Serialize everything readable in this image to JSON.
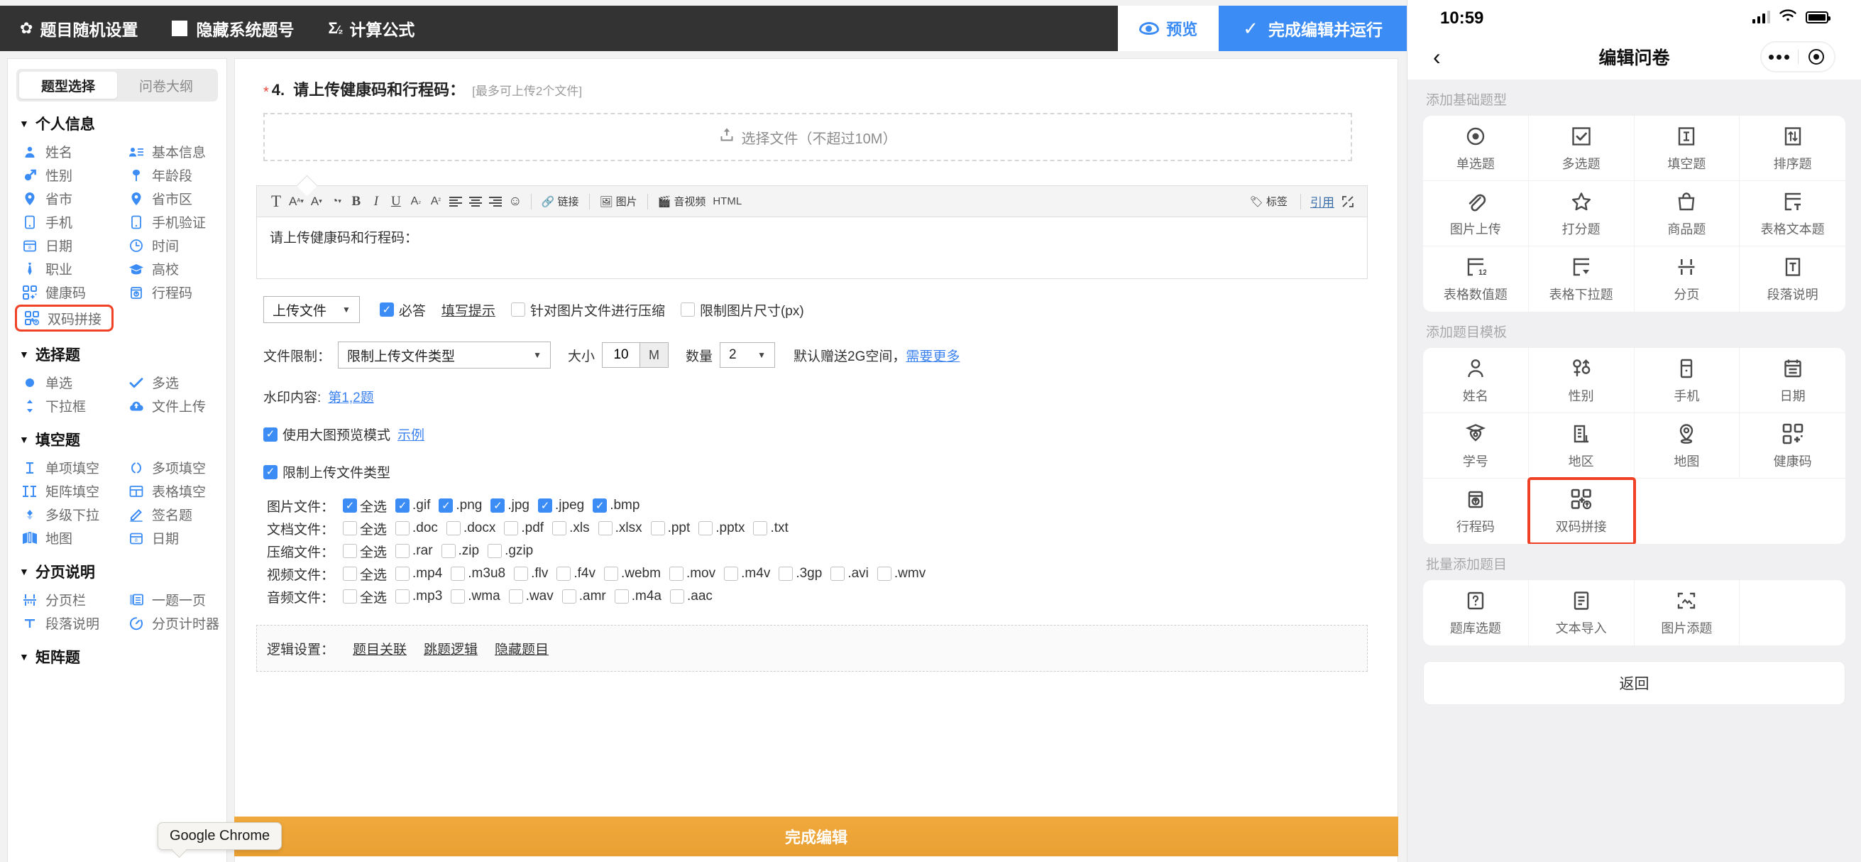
{
  "topbar": {
    "random_settings": "题目随机设置",
    "hide_number": "隐藏系统题号",
    "formula": "计算公式",
    "preview": "预览",
    "finish_run": "完成编辑并运行"
  },
  "sidebar": {
    "tabs": [
      {
        "label": "题型选择",
        "active": true
      },
      {
        "label": "问卷大纲",
        "active": false
      }
    ],
    "groups": [
      {
        "title": "个人信息",
        "items": [
          {
            "label": "姓名",
            "icon": "person-icon"
          },
          {
            "label": "基本信息",
            "icon": "id-card-icon"
          },
          {
            "label": "性别",
            "icon": "gender-icon"
          },
          {
            "label": "年龄段",
            "icon": "age-icon"
          },
          {
            "label": "省市",
            "icon": "pin-icon"
          },
          {
            "label": "省市区",
            "icon": "pin-icon"
          },
          {
            "label": "手机",
            "icon": "phone-icon"
          },
          {
            "label": "手机验证",
            "icon": "phone-verify-icon"
          },
          {
            "label": "日期",
            "icon": "calendar-icon"
          },
          {
            "label": "时间",
            "icon": "clock-icon"
          },
          {
            "label": "职业",
            "icon": "tie-icon"
          },
          {
            "label": "高校",
            "icon": "graduation-icon"
          },
          {
            "label": "健康码",
            "icon": "qrcode-icon"
          },
          {
            "label": "行程码",
            "icon": "travelcode-icon"
          },
          {
            "label": "双码拼接",
            "icon": "dualcode-icon",
            "highlight": true
          }
        ]
      },
      {
        "title": "选择题",
        "items": [
          {
            "label": "单选",
            "icon": "radio-icon"
          },
          {
            "label": "多选",
            "icon": "check-icon"
          },
          {
            "label": "下拉框",
            "icon": "dropdown-icon"
          },
          {
            "label": "文件上传",
            "icon": "cloud-upload-icon"
          }
        ]
      },
      {
        "title": "填空题",
        "items": [
          {
            "label": "单项填空",
            "icon": "text-i-icon"
          },
          {
            "label": "多项填空",
            "icon": "parens-icon"
          },
          {
            "label": "矩阵填空",
            "icon": "text-ii-icon"
          },
          {
            "label": "表格填空",
            "icon": "table-icon"
          },
          {
            "label": "多级下拉",
            "icon": "multi-dropdown-icon"
          },
          {
            "label": "签名题",
            "icon": "signature-icon"
          },
          {
            "label": "地图",
            "icon": "map-icon"
          },
          {
            "label": "日期",
            "icon": "calendar-icon"
          }
        ]
      },
      {
        "title": "分页说明",
        "items": [
          {
            "label": "分页栏",
            "icon": "pagebreak-icon"
          },
          {
            "label": "一题一页",
            "icon": "one-per-page-icon"
          },
          {
            "label": "段落说明",
            "icon": "paragraph-icon"
          },
          {
            "label": "分页计时器",
            "icon": "timer-icon"
          }
        ]
      },
      {
        "title": "矩阵题",
        "items": []
      }
    ]
  },
  "question": {
    "required_mark": "*",
    "number": "4.",
    "title": "请上传健康码和行程码：",
    "hint": "[最多可上传2个文件]",
    "dropzone_text": "选择文件（不超过10M）"
  },
  "editor": {
    "buttons": [
      "T",
      "A",
      "A",
      "pen",
      "B",
      "I",
      "U",
      "As",
      "As"
    ],
    "align": [
      "align-left",
      "align-center",
      "align-right"
    ],
    "emoji": "☺",
    "link_label": "链接",
    "image_label": "图片",
    "media_label": "音视频",
    "html_label": "HTML",
    "tag_label": "标签",
    "quote_label": "引用",
    "body_text": "请上传健康码和行程码："
  },
  "settings": {
    "type_select": "上传文件",
    "required_label": "必答",
    "required_checked": true,
    "fill_hint_link": "填写提示",
    "compress_label": "针对图片文件进行压缩",
    "compress_checked": false,
    "limit_size_label": "限制图片尺寸(px)",
    "limit_size_checked": false,
    "file_limit_label": "文件限制：",
    "file_limit_value": "限制上传文件类型",
    "size_label": "大小",
    "size_value": "10",
    "size_unit": "M",
    "count_label": "数量",
    "count_value": "2",
    "storage_note": "默认赠送2G空间，",
    "storage_link": "需要更多",
    "watermark_label": "水印内容:",
    "watermark_link": "第1,2题",
    "big_preview_label": "使用大图预览模式",
    "big_preview_checked": true,
    "big_preview_link": "示例",
    "restrict_types_label": "限制上传文件类型",
    "restrict_types_checked": true
  },
  "file_types": [
    {
      "label": "图片文件：",
      "all_label": "全选",
      "all_checked": true,
      "options": [
        {
          "label": ".gif",
          "checked": true
        },
        {
          "label": ".png",
          "checked": true
        },
        {
          "label": ".jpg",
          "checked": true
        },
        {
          "label": ".jpeg",
          "checked": true
        },
        {
          "label": ".bmp",
          "checked": true
        }
      ]
    },
    {
      "label": "文档文件：",
      "all_label": "全选",
      "all_checked": false,
      "options": [
        {
          "label": ".doc",
          "checked": false
        },
        {
          "label": ".docx",
          "checked": false
        },
        {
          "label": ".pdf",
          "checked": false
        },
        {
          "label": ".xls",
          "checked": false
        },
        {
          "label": ".xlsx",
          "checked": false
        },
        {
          "label": ".ppt",
          "checked": false
        },
        {
          "label": ".pptx",
          "checked": false
        },
        {
          "label": ".txt",
          "checked": false
        }
      ]
    },
    {
      "label": "压缩文件：",
      "all_label": "全选",
      "all_checked": false,
      "options": [
        {
          "label": ".rar",
          "checked": false
        },
        {
          "label": ".zip",
          "checked": false
        },
        {
          "label": ".gzip",
          "checked": false
        }
      ]
    },
    {
      "label": "视频文件：",
      "all_label": "全选",
      "all_checked": false,
      "options": [
        {
          "label": ".mp4",
          "checked": false
        },
        {
          "label": ".m3u8",
          "checked": false
        },
        {
          "label": ".flv",
          "checked": false
        },
        {
          "label": ".f4v",
          "checked": false
        },
        {
          "label": ".webm",
          "checked": false
        },
        {
          "label": ".mov",
          "checked": false
        },
        {
          "label": ".m4v",
          "checked": false
        },
        {
          "label": ".3gp",
          "checked": false
        },
        {
          "label": ".avi",
          "checked": false
        },
        {
          "label": ".wmv",
          "checked": false
        }
      ]
    },
    {
      "label": "音频文件：",
      "all_label": "全选",
      "all_checked": false,
      "options": [
        {
          "label": ".mp3",
          "checked": false
        },
        {
          "label": ".wma",
          "checked": false
        },
        {
          "label": ".wav",
          "checked": false
        },
        {
          "label": ".amr",
          "checked": false
        },
        {
          "label": ".m4a",
          "checked": false
        },
        {
          "label": ".aac",
          "checked": false
        }
      ]
    }
  ],
  "logic": {
    "label": "逻辑设置：",
    "links": [
      "题目关联",
      "跳题逻辑",
      "隐藏题目"
    ]
  },
  "finish_bar": {
    "label": "完成编辑"
  },
  "tooltip": {
    "text": "Google Chrome"
  },
  "phone": {
    "status": {
      "time": "10:59"
    },
    "nav": {
      "title": "编辑问卷",
      "back": "‹"
    },
    "sections": [
      {
        "title": "添加基础题型",
        "items": [
          {
            "label": "单选题",
            "icon": "radio-dot-icon"
          },
          {
            "label": "多选题",
            "icon": "checkbox-icon"
          },
          {
            "label": "填空题",
            "icon": "text-field-icon"
          },
          {
            "label": "排序题",
            "icon": "sort-icon"
          },
          {
            "label": "图片上传",
            "icon": "paperclip-icon"
          },
          {
            "label": "打分题",
            "icon": "star-icon"
          },
          {
            "label": "商品题",
            "icon": "bag-icon"
          },
          {
            "label": "表格文本题",
            "icon": "table-text-icon"
          },
          {
            "label": "表格数值题",
            "icon": "table-number-icon"
          },
          {
            "label": "表格下拉题",
            "icon": "table-dropdown-icon"
          },
          {
            "label": "分页",
            "icon": "pagebreak-icon"
          },
          {
            "label": "段落说明",
            "icon": "paragraph-box-icon"
          }
        ]
      },
      {
        "title": "添加题目模板",
        "items": [
          {
            "label": "姓名",
            "icon": "person-icon"
          },
          {
            "label": "性别",
            "icon": "gender-icon"
          },
          {
            "label": "手机",
            "icon": "phone-icon"
          },
          {
            "label": "日期",
            "icon": "calendar-icon"
          },
          {
            "label": "学号",
            "icon": "student-icon"
          },
          {
            "label": "地区",
            "icon": "building-icon"
          },
          {
            "label": "地图",
            "icon": "map-pin-icon"
          },
          {
            "label": "健康码",
            "icon": "qrcode-icon"
          },
          {
            "label": "行程码",
            "icon": "travelcode-icon"
          },
          {
            "label": "双码拼接",
            "icon": "dualcode-icon",
            "highlight": true
          }
        ]
      },
      {
        "title": "批量添加题目",
        "items": [
          {
            "label": "题库选题",
            "icon": "question-bank-icon"
          },
          {
            "label": "文本导入",
            "icon": "text-import-icon"
          },
          {
            "label": "图片添题",
            "icon": "image-add-icon"
          }
        ]
      }
    ],
    "back_button": "返回"
  }
}
